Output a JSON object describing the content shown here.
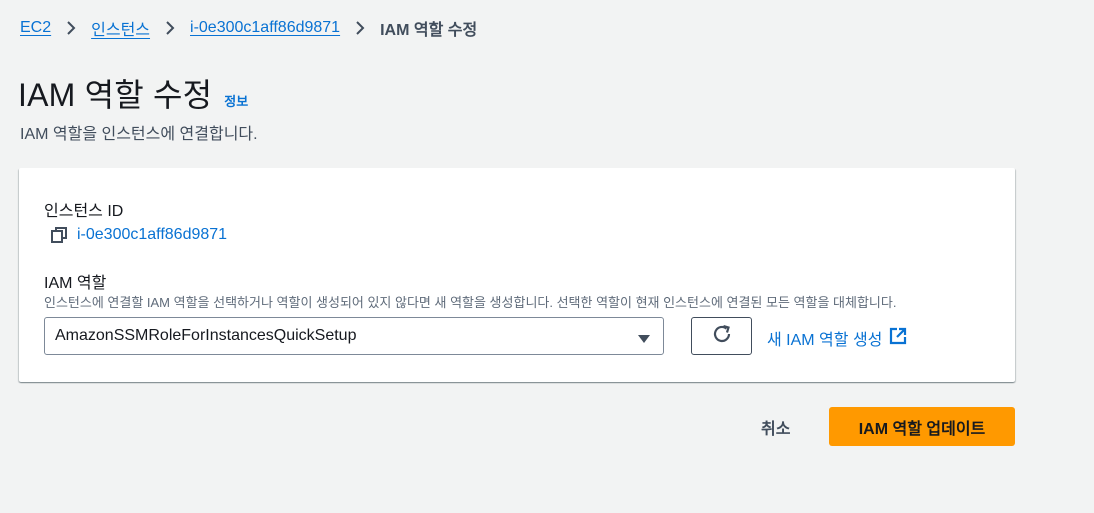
{
  "breadcrumb": {
    "items": [
      "EC2",
      "인스턴스",
      "i-0e300c1aff86d9871"
    ],
    "current": "IAM 역할 수정"
  },
  "header": {
    "title": "IAM 역할 수정",
    "info_label": "정보",
    "description": "IAM 역할을 인스턴스에 연결합니다."
  },
  "form": {
    "instance_id_label": "인스턴스 ID",
    "instance_id_value": "i-0e300c1aff86d9871",
    "iam_role_label": "IAM 역할",
    "iam_role_hint": "인스턴스에 연결할 IAM 역할을 선택하거나 역할이 생성되어 있지 않다면 새 역할을 생성합니다. 선택한 역할이 현재 인스턴스에 연결된 모든 역할을 대체합니다.",
    "iam_role_selected": "AmazonSSMRoleForInstancesQuickSetup",
    "create_role_link": "새 IAM 역할 생성"
  },
  "actions": {
    "cancel_label": "취소",
    "submit_label": "IAM 역할 업데이트"
  },
  "icons": {
    "breadcrumb_separator": "chevron-right-icon",
    "copy": "copy-icon",
    "select_caret": "caret-down-icon",
    "refresh": "refresh-icon",
    "external_link": "external-link-icon"
  },
  "colors": {
    "background": "#f2f3f3",
    "link": "#0972d3",
    "primary_button": "#ff9900",
    "text": "#16191f"
  }
}
